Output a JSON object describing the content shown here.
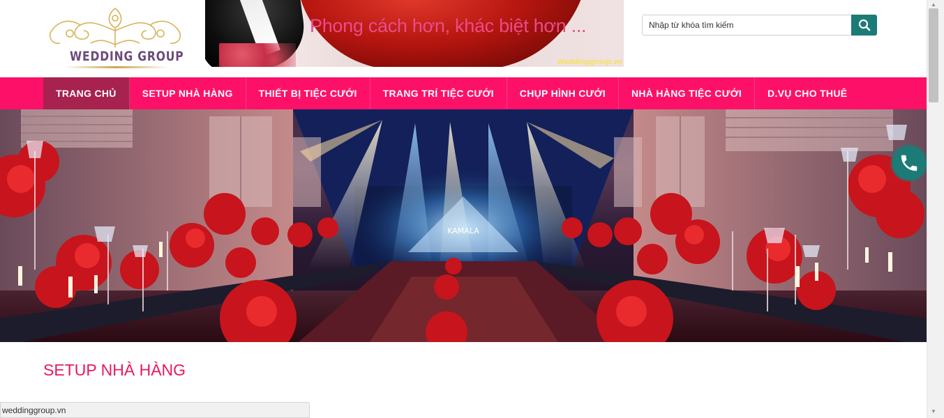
{
  "logo": {
    "text": "WEDDING GROUP"
  },
  "banner": {
    "slogan": "Phong cách hơn, khác biệt hơn ...",
    "watermark": "Weddinggroup.vn"
  },
  "search": {
    "placeholder": "Nhập từ khóa tìm kiếm",
    "button_icon": "search-icon"
  },
  "nav": {
    "items": [
      {
        "label": "TRANG CHỦ",
        "active": true
      },
      {
        "label": "SETUP NHÀ HÀNG",
        "active": false
      },
      {
        "label": "THIẾT BỊ TIỆC CƯỚI",
        "active": false
      },
      {
        "label": "TRANG TRÍ TIỆC CƯỚI",
        "active": false
      },
      {
        "label": "CHỤP HÌNH CƯỚI",
        "active": false
      },
      {
        "label": "NHÀ HÀNG TIỆC CƯỚI",
        "active": false
      },
      {
        "label": "D.VỤ CHO THUÊ",
        "active": false
      }
    ]
  },
  "hero": {
    "stage_text": "KAMALA"
  },
  "section": {
    "title": "SETUP NHÀ HÀNG"
  },
  "statusbar": {
    "url": "weddinggroup.vn"
  },
  "phone": {
    "icon": "phone-icon"
  },
  "colors": {
    "nav": "#fd1168",
    "nav_active": "#a7224e",
    "accent_teal": "#1c7a77",
    "section_title": "#e8185f"
  }
}
